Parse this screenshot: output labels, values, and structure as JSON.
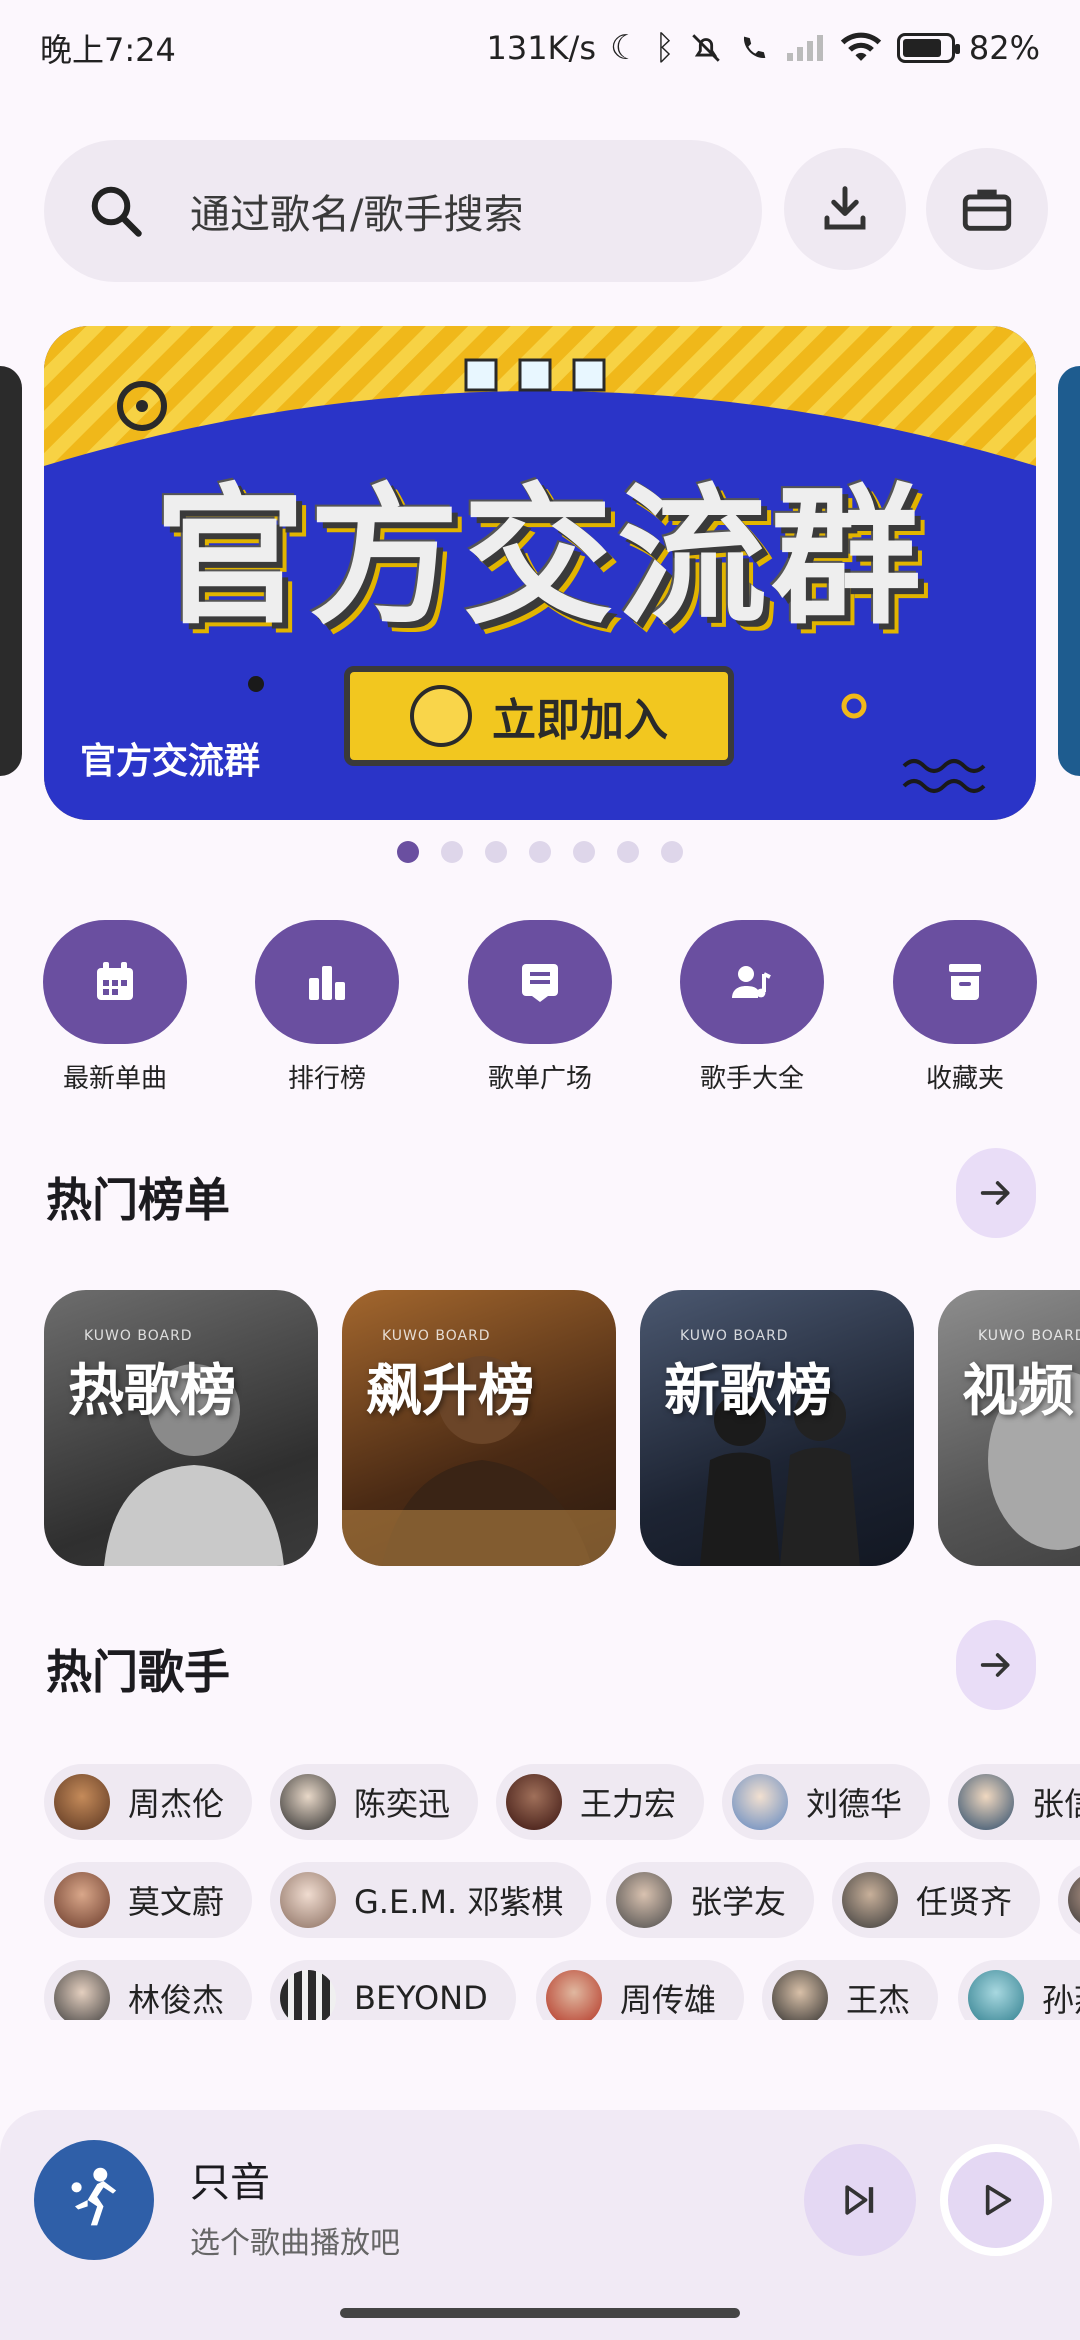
{
  "status_bar": {
    "time": "晚上7:24",
    "net_speed": "131K/s",
    "battery": "82%",
    "battery_level": 0.82
  },
  "search": {
    "placeholder": "通过歌名/歌手搜索",
    "icon": "search-icon"
  },
  "header_buttons": {
    "download_icon": "download-icon",
    "toolbox_icon": "briefcase-icon"
  },
  "banner": {
    "title": "官方交流群",
    "join_label": "立即加入",
    "caption": "官方交流群",
    "page_count": 7,
    "active_page": 1
  },
  "quick_actions": [
    {
      "label": "最新单曲",
      "icon": "calendar-icon"
    },
    {
      "label": "排行榜",
      "icon": "bar-chart-icon"
    },
    {
      "label": "歌单广场",
      "icon": "playlist-icon"
    },
    {
      "label": "歌手大全",
      "icon": "singer-icon"
    },
    {
      "label": "收藏夹",
      "icon": "archive-icon"
    }
  ],
  "hot_charts": {
    "title": "热门榜单",
    "items": [
      {
        "name": "热歌榜",
        "badge": "KUWO BOARD"
      },
      {
        "name": "飙升榜",
        "badge": "KUWO BOARD"
      },
      {
        "name": "新歌榜",
        "badge": "KUWO BOARD"
      },
      {
        "name": "视频",
        "badge": "KUWO BOARD"
      }
    ]
  },
  "hot_singers": {
    "title": "热门歌手",
    "rows": [
      [
        "周杰伦",
        "陈奕迅",
        "王力宏",
        "刘德华",
        "张信"
      ],
      [
        "莫文蔚",
        "G.E.M. 邓紫棋",
        "张学友",
        "任贤齐",
        ""
      ],
      [
        "林俊杰",
        "BEYOND",
        "周传雄",
        "王杰",
        "孙燕"
      ]
    ]
  },
  "player": {
    "title": "只音",
    "subtitle": "选个歌曲播放吧"
  }
}
